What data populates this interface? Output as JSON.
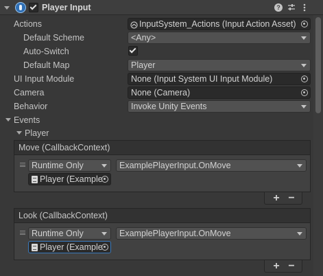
{
  "header": {
    "title": "Player Input",
    "enabled": true,
    "icons": [
      "help-icon",
      "preset-icon",
      "more-icon"
    ]
  },
  "fields": {
    "actions": {
      "label": "Actions",
      "value": "InputSystem_Actions (Input Action Asset)"
    },
    "default_scheme": {
      "label": "Default Scheme",
      "value": "<Any>"
    },
    "auto_switch": {
      "label": "Auto-Switch",
      "checked": true
    },
    "default_map": {
      "label": "Default Map",
      "value": "Player"
    },
    "ui_input_module": {
      "label": "UI Input Module",
      "value": "None (Input System UI Input Module)"
    },
    "camera": {
      "label": "Camera",
      "value": "None (Camera)"
    },
    "behavior": {
      "label": "Behavior",
      "value": "Invoke Unity Events"
    }
  },
  "events": {
    "label": "Events",
    "player_label": "Player",
    "move": {
      "header": "Move (CallbackContext)",
      "runtime": "Runtime Only",
      "function": "ExamplePlayerInput.OnMove",
      "object": "Player (Example"
    },
    "look": {
      "header": "Look (CallbackContext)",
      "runtime": "Runtime Only",
      "function": "ExamplePlayerInput.OnMove",
      "object": "Player (Example"
    },
    "plus": "+",
    "minus": "−"
  },
  "colors": {
    "background": "#383838",
    "accent_focus": "#3a79bb",
    "component_icon": "#2f6fb5"
  }
}
